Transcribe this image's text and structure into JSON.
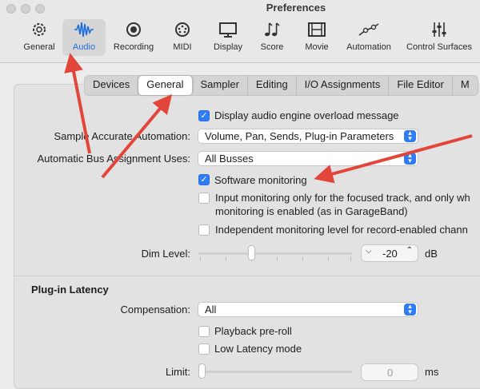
{
  "window": {
    "title": "Preferences"
  },
  "toolbar": [
    {
      "label": "General",
      "icon": "gear-icon"
    },
    {
      "label": "Audio",
      "icon": "waveform-icon"
    },
    {
      "label": "Recording",
      "icon": "record-icon"
    },
    {
      "label": "MIDI",
      "icon": "midi-port-icon"
    },
    {
      "label": "Display",
      "icon": "monitor-icon"
    },
    {
      "label": "Score",
      "icon": "music-notes-icon"
    },
    {
      "label": "Movie",
      "icon": "film-icon"
    },
    {
      "label": "Automation",
      "icon": "automation-curve-icon"
    },
    {
      "label": "Control Surfaces",
      "icon": "sliders-icon"
    }
  ],
  "tabs": [
    "Devices",
    "General",
    "Sampler",
    "Editing",
    "I/O Assignments",
    "File Editor",
    "M"
  ],
  "general": {
    "display_overload": "Display audio engine overload message",
    "sample_accurate_label": "Sample Accurate Automation:",
    "sample_accurate_value": "Volume, Pan, Sends, Plug-in Parameters",
    "bus_assignment_label": "Automatic Bus Assignment Uses:",
    "bus_assignment_value": "All Busses",
    "software_monitoring": "Software monitoring",
    "input_monitoring_line1": "Input monitoring only for the focused track, and only wh",
    "input_monitoring_line2": "monitoring is enabled (as in GarageBand)",
    "independent_monitoring": "Independent monitoring level for record-enabled chann",
    "dim_level_label": "Dim Level:",
    "dim_level_value": "-20",
    "dim_unit": "dB"
  },
  "latency": {
    "title": "Plug-in Latency",
    "compensation_label": "Compensation:",
    "compensation_value": "All",
    "playback_preroll": "Playback pre-roll",
    "low_latency": "Low Latency mode",
    "limit_label": "Limit:",
    "limit_value": "0",
    "limit_unit": "ms"
  },
  "checkbox_states": {
    "display_overload": true,
    "software_monitoring": true,
    "input_monitoring": false,
    "independent_monitoring": false,
    "playback_preroll": false,
    "low_latency": false
  },
  "colors": {
    "accent": "#2f7cf6",
    "annotation_arrow": "#e2463a"
  }
}
